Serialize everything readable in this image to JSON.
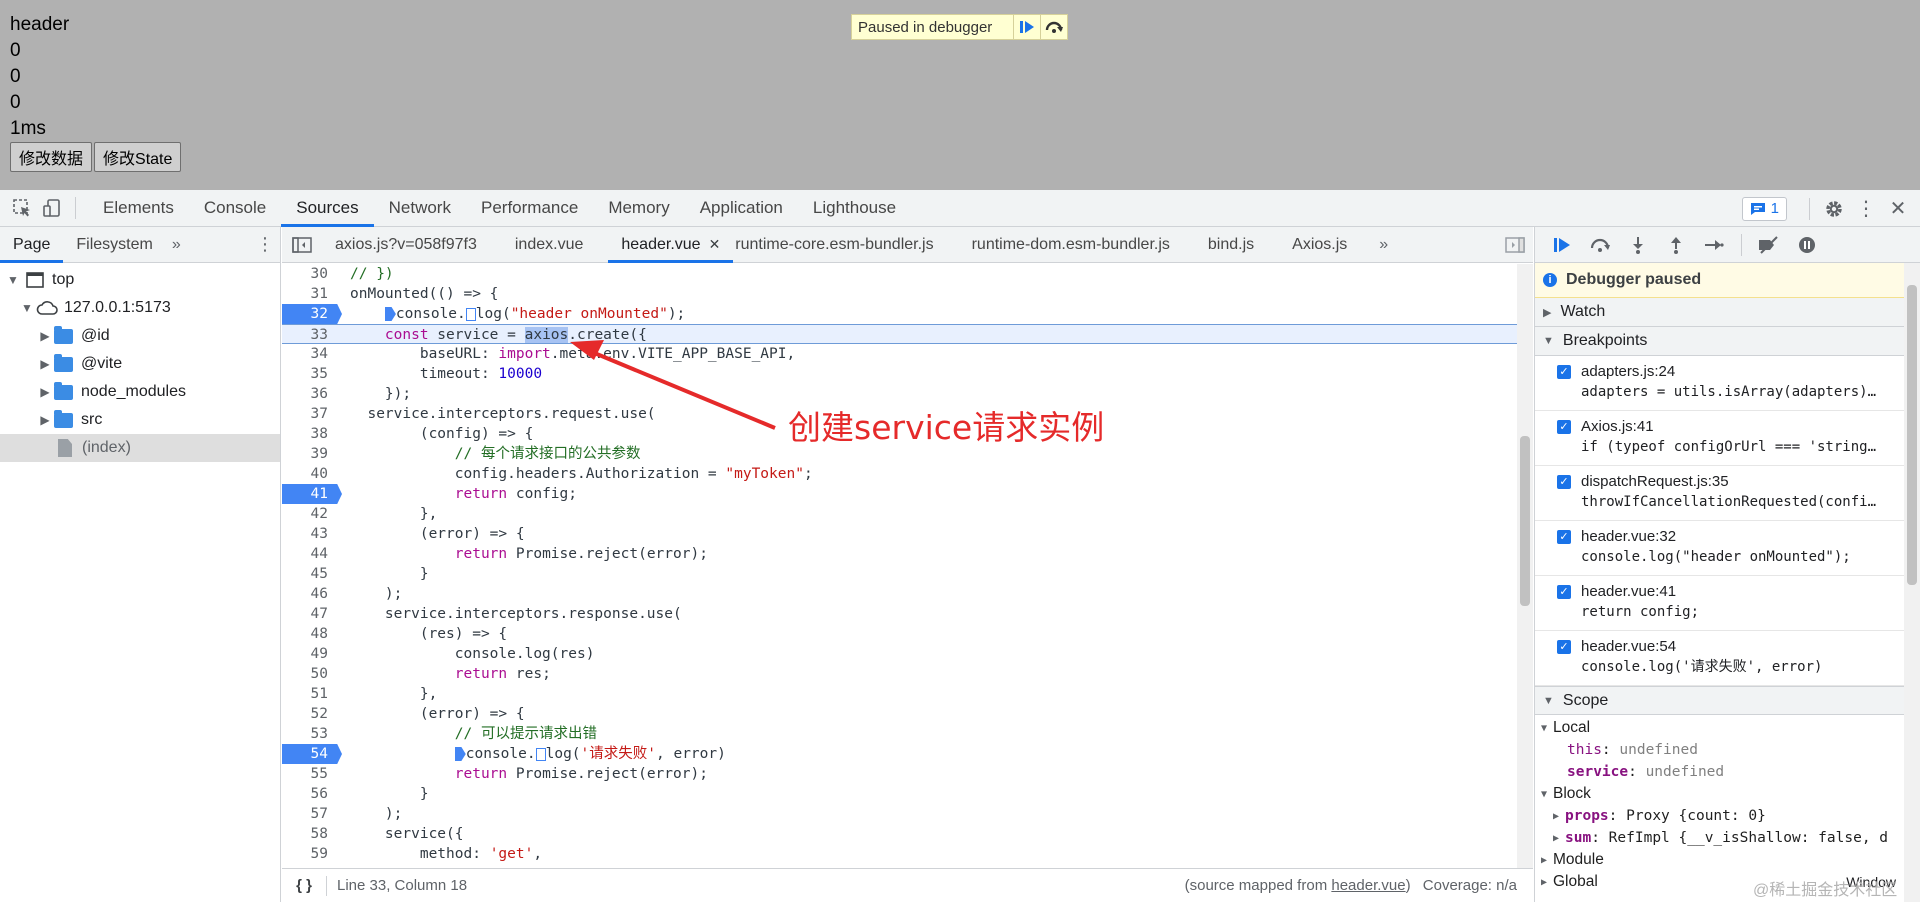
{
  "viewport": {
    "lines": [
      "header",
      "0",
      "0",
      "0",
      "1ms"
    ],
    "buttons": [
      "修改数据",
      "修改State"
    ],
    "paused_banner": "Paused in debugger"
  },
  "devtools": {
    "tabs": [
      "Elements",
      "Console",
      "Sources",
      "Network",
      "Performance",
      "Memory",
      "Application",
      "Lighthouse"
    ],
    "active_tab": "Sources",
    "issues_count": "1",
    "nav": {
      "tabs": [
        "Page",
        "Filesystem"
      ],
      "active": "Page",
      "tree": [
        {
          "label": "top",
          "depth": 0,
          "icon": "frame-icon"
        },
        {
          "label": "127.0.0.1:5173",
          "depth": 1,
          "icon": "cloud-icon"
        },
        {
          "label": "@id",
          "depth": 2,
          "icon": "folder-icon"
        },
        {
          "label": "@vite",
          "depth": 2,
          "icon": "folder-icon"
        },
        {
          "label": "node_modules",
          "depth": 2,
          "icon": "folder-icon"
        },
        {
          "label": "src",
          "depth": 2,
          "icon": "folder-icon"
        },
        {
          "label": "(index)",
          "depth": 2,
          "icon": "file-icon",
          "selected": true
        }
      ]
    },
    "file_tabs": [
      "axios.js?v=058f97f3",
      "index.vue",
      "header.vue",
      "runtime-core.esm-bundler.js",
      "runtime-dom.esm-bundler.js",
      "bind.js",
      "Axios.js"
    ],
    "active_file": "header.vue",
    "status": {
      "position": "Line 33, Column 18",
      "mapped_prefix": "(source mapped from ",
      "mapped_file": "header.vue",
      "mapped_suffix": ")",
      "coverage": "Coverage: n/a"
    },
    "annotation": "创建service请求实例",
    "debugger": {
      "paused_title": "Debugger paused",
      "sections": {
        "watch": "Watch",
        "breakpoints": "Breakpoints",
        "scope": "Scope"
      },
      "breakpoints": [
        {
          "location": "adapters.js:24",
          "code": "adapters = utils.isArray(adapters) ? adapters : [adapters];"
        },
        {
          "location": "Axios.js:41",
          "code": "if (typeof configOrUrl === 'string') {"
        },
        {
          "location": "dispatchRequest.js:35",
          "code": "throwIfCancellationRequested(config);"
        },
        {
          "location": "header.vue:32",
          "code": "console.log(\"header onMounted\");"
        },
        {
          "location": "header.vue:41",
          "code": "return config;"
        },
        {
          "location": "header.vue:54",
          "code": "console.log('请求失败', error)"
        }
      ],
      "scope": {
        "local_label": "Local",
        "this_name": "this",
        "this_value": "undefined",
        "service_name": "service",
        "service_value": "undefined",
        "block_label": "Block",
        "props_name": "props",
        "props_value": "Proxy {count: 0}",
        "sum_name": "sum",
        "sum_value": "RefImpl {__v_isShallow: false, d",
        "module_label": "Module",
        "global_label": "Global",
        "global_value": "Window"
      }
    }
  },
  "watermark": "@稀土掘金技术社区",
  "colors": {
    "accent": "#1a73e8",
    "breakpoint": "#4285f4",
    "annotation": "#e52a2a",
    "paused_bg": "#ffffd2"
  }
}
